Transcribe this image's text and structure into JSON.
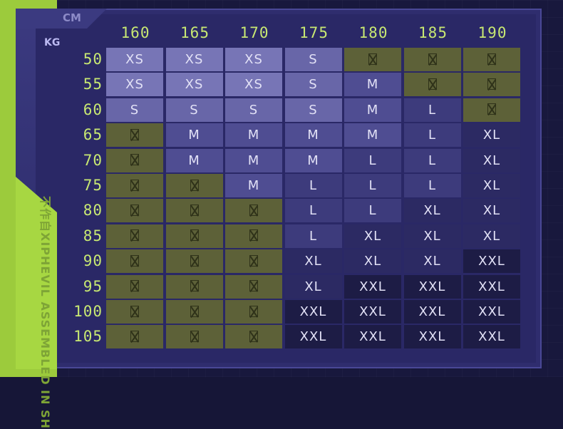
{
  "labels": {
    "cm": "CM",
    "kg": "KG",
    "side_text": "不作自XIPHEVIL ASSEMBLED IN SH"
  },
  "heights": [
    "160",
    "165",
    "170",
    "175",
    "180",
    "185",
    "190"
  ],
  "weights": [
    "50",
    "55",
    "60",
    "65",
    "70",
    "75",
    "80",
    "85",
    "90",
    "95",
    "100",
    "105"
  ],
  "sizes": [
    [
      "XS",
      "XS",
      "XS",
      "S",
      "",
      "",
      ""
    ],
    [
      "XS",
      "XS",
      "XS",
      "S",
      "M",
      "",
      ""
    ],
    [
      "S",
      "S",
      "S",
      "S",
      "M",
      "L",
      ""
    ],
    [
      "",
      "M",
      "M",
      "M",
      "M",
      "L",
      "XL"
    ],
    [
      "",
      "M",
      "M",
      "M",
      "L",
      "L",
      "XL"
    ],
    [
      "",
      "",
      "M",
      "L",
      "L",
      "L",
      "XL"
    ],
    [
      "",
      "",
      "",
      "L",
      "L",
      "XL",
      "XL"
    ],
    [
      "",
      "",
      "",
      "L",
      "XL",
      "XL",
      "XL"
    ],
    [
      "",
      "",
      "",
      "XL",
      "XL",
      "XL",
      "XXL"
    ],
    [
      "",
      "",
      "",
      "XL",
      "XXL",
      "XXL",
      "XXL"
    ],
    [
      "",
      "",
      "",
      "XXL",
      "XXL",
      "XXL",
      "XXL"
    ],
    [
      "",
      "",
      "",
      "XXL",
      "XXL",
      "XXL",
      "XXL"
    ]
  ],
  "unavailable_icon": "x-box-icon",
  "colors": {
    "unavailable": "#5d6138",
    "accent_green": "#a7d742",
    "label_yellow": "#c8e872"
  }
}
